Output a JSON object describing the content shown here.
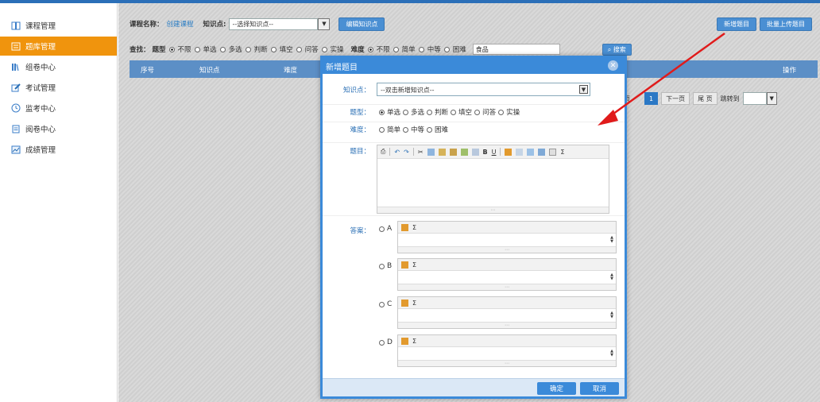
{
  "sidebar": {
    "items": [
      {
        "label": "课程管理",
        "icon": "book-icon",
        "active": false
      },
      {
        "label": "题库管理",
        "icon": "question-bank-icon",
        "active": true
      },
      {
        "label": "组卷中心",
        "icon": "library-icon",
        "active": false
      },
      {
        "label": "考试管理",
        "icon": "edit-icon",
        "active": false
      },
      {
        "label": "监考中心",
        "icon": "clock-icon",
        "active": false
      },
      {
        "label": "阅卷中心",
        "icon": "document-icon",
        "active": false
      },
      {
        "label": "成绩管理",
        "icon": "chart-icon",
        "active": false
      }
    ]
  },
  "toolbar": {
    "course_label": "课程名称：",
    "course_link": "创建课程",
    "kp_label": "知识点:",
    "kp_value": "--选择知识点--",
    "edit_kp_button": "编辑知识点",
    "new_question_button": "新增题目",
    "batch_upload_button": "批量上传题目"
  },
  "filter": {
    "find_label": "查找：",
    "type_label": "题型",
    "types": [
      "不限",
      "单选",
      "多选",
      "判断",
      "填空",
      "问答",
      "实操"
    ],
    "difficulty_label": "难度",
    "difficulties": [
      "不限",
      "简单",
      "中等",
      "困难"
    ],
    "search_value": "食品",
    "search_button": "搜索"
  },
  "table": {
    "columns": [
      "序号",
      "知识点",
      "难度",
      "操作"
    ]
  },
  "pager": {
    "prev_partial": "页",
    "current": "1",
    "next": "下一页",
    "last": "尾 页",
    "jump": "跳转到"
  },
  "modal": {
    "title": "新增题目",
    "kp_label": "知识点：",
    "kp_value": "--双击新增知识点--",
    "type_label": "题型：",
    "types": [
      "单选",
      "多选",
      "判断",
      "填空",
      "问答",
      "实操"
    ],
    "difficulty_label": "难度：",
    "difficulties": [
      "简单",
      "中等",
      "困难"
    ],
    "question_label": "题目：",
    "answer_label": "答案：",
    "options": [
      "A",
      "B",
      "C",
      "D"
    ],
    "confirm_button": "确定",
    "cancel_button": "取消"
  },
  "colors": {
    "accent": "#3b8ad9",
    "sidebar_active": "#f0940d",
    "arrow": "#e01b1b"
  }
}
